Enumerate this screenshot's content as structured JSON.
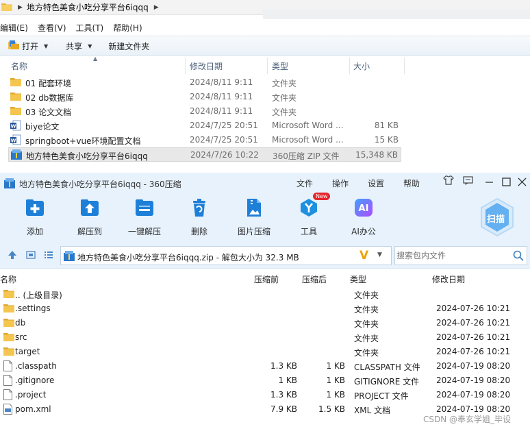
{
  "explorer": {
    "path": "地方特色美食小吃分享平台6iqqq",
    "menu": [
      "编辑(E)",
      "查看(V)",
      "工具(T)",
      "帮助(H)"
    ],
    "toolbar": {
      "open": "打开",
      "share": "共享",
      "new_folder": "新建文件夹"
    },
    "columns": {
      "name": "名称",
      "date": "修改日期",
      "type": "类型",
      "size": "大小"
    },
    "rows": [
      {
        "name": "01 配套环境",
        "date": "2024/8/11 9:11",
        "type": "文件夹",
        "size": "",
        "icon": "folder-icon"
      },
      {
        "name": "02 db数据库",
        "date": "2024/8/11 9:11",
        "type": "文件夹",
        "size": "",
        "icon": "folder-icon"
      },
      {
        "name": "03 论文文档",
        "date": "2024/8/11 9:11",
        "type": "文件夹",
        "size": "",
        "icon": "folder-icon"
      },
      {
        "name": "biye论文",
        "date": "2024/7/25 20:51",
        "type": "Microsoft Word ...",
        "size": "81 KB",
        "icon": "word-doc-icon"
      },
      {
        "name": "springboot+vue环境配置文档",
        "date": "2024/7/25 20:51",
        "type": "Microsoft Word ...",
        "size": "15 KB",
        "icon": "word-doc-icon"
      },
      {
        "name": "地方特色美食小吃分享平台6iqqq",
        "date": "2024/7/26 10:22",
        "type": "360压缩 ZIP 文件",
        "size": "15,348 KB",
        "icon": "zip-icon"
      }
    ]
  },
  "zip_app": {
    "title": "地方特色美食小吃分享平台6iqqq - 360压缩",
    "menu": [
      "文件",
      "操作",
      "设置",
      "帮助"
    ],
    "tools": [
      {
        "label": "添加",
        "icon": "add-icon"
      },
      {
        "label": "解压到",
        "icon": "extract-to-icon"
      },
      {
        "label": "一键解压",
        "icon": "one-click-extract-icon"
      },
      {
        "label": "删除",
        "icon": "delete-icon"
      },
      {
        "label": "图片压缩",
        "icon": "image-compress-icon"
      },
      {
        "label": "工具",
        "icon": "tools-icon",
        "badge": "New"
      },
      {
        "label": "AI办公",
        "icon": "ai-office-icon"
      }
    ],
    "scan_label": "扫描",
    "path_text": "地方特色美食小吃分享平台6iqqq.zip - 解包大小为 32.3 MB",
    "search_placeholder": "搜索包内文件",
    "columns": {
      "name": "名称",
      "compressed": "压缩前",
      "original": "压缩后",
      "type": "类型",
      "date": "修改日期"
    },
    "rows": [
      {
        "name": ".. (上级目录)",
        "csize": "",
        "osize": "",
        "type": "文件夹",
        "date": "",
        "icon": "folder-icon"
      },
      {
        "name": ".settings",
        "csize": "",
        "osize": "",
        "type": "文件夹",
        "date": "2024-07-26 10:21",
        "icon": "folder-icon"
      },
      {
        "name": "db",
        "csize": "",
        "osize": "",
        "type": "文件夹",
        "date": "2024-07-26 10:21",
        "icon": "folder-icon"
      },
      {
        "name": "src",
        "csize": "",
        "osize": "",
        "type": "文件夹",
        "date": "2024-07-26 10:21",
        "icon": "folder-icon"
      },
      {
        "name": "target",
        "csize": "",
        "osize": "",
        "type": "文件夹",
        "date": "2024-07-26 10:21",
        "icon": "folder-icon"
      },
      {
        "name": ".classpath",
        "csize": "1.3 KB",
        "osize": "1 KB",
        "type": "CLASSPATH 文件",
        "date": "2024-07-19 08:20",
        "icon": "file-icon"
      },
      {
        "name": ".gitignore",
        "csize": "1 KB",
        "osize": "1 KB",
        "type": "GITIGNORE 文件",
        "date": "2024-07-19 08:20",
        "icon": "file-icon"
      },
      {
        "name": ".project",
        "csize": "1.3 KB",
        "osize": "1 KB",
        "type": "PROJECT 文件",
        "date": "2024-07-19 08:20",
        "icon": "file-icon"
      },
      {
        "name": "pom.xml",
        "csize": "7.9 KB",
        "osize": "1.5 KB",
        "type": "XML 文档",
        "date": "2024-07-19 08:20",
        "icon": "xml-file-icon"
      }
    ]
  },
  "watermark": "CSDN @奉玄学姐_毕设",
  "colors": {
    "zip_bg": "#e7f2fd",
    "folder": "#f2c14e",
    "accent_blue": "#1e88e5"
  }
}
